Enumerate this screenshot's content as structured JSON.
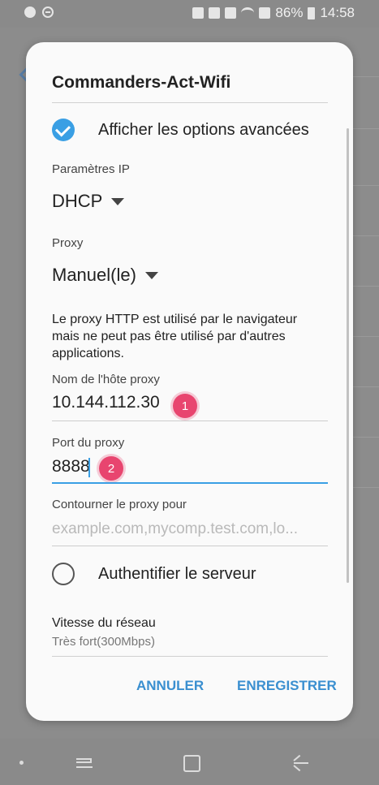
{
  "status_bar": {
    "battery": "86%",
    "time": "14:58"
  },
  "dialog": {
    "title": "Commanders-Act-Wifi",
    "advanced_options_label": "Afficher les options avancées",
    "ip_settings_label": "Paramètres IP",
    "ip_settings_value": "DHCP",
    "proxy_label": "Proxy",
    "proxy_value": "Manuel(le)",
    "proxy_info": "Le proxy HTTP est utilisé par le navigateur mais ne peut pas être utilisé par d'autres applications.",
    "proxy_host_label": "Nom de l'hôte proxy",
    "proxy_host_value": "10.144.112.30",
    "badge_1": "1",
    "proxy_port_label": "Port du proxy",
    "proxy_port_value": "8888",
    "badge_2": "2",
    "bypass_label": "Contourner le proxy pour",
    "bypass_placeholder": "example.com,mycomp.test.com,lo...",
    "auth_label": "Authentifier le serveur",
    "speed_label": "Vitesse du réseau",
    "speed_value": "Très fort(300Mbps)",
    "cancel_button": "ANNULER",
    "save_button": "ENREGISTRER"
  },
  "colors": {
    "accent": "#3a9fe4",
    "badge": "#e8456f",
    "button_text": "#3a8fd0"
  }
}
